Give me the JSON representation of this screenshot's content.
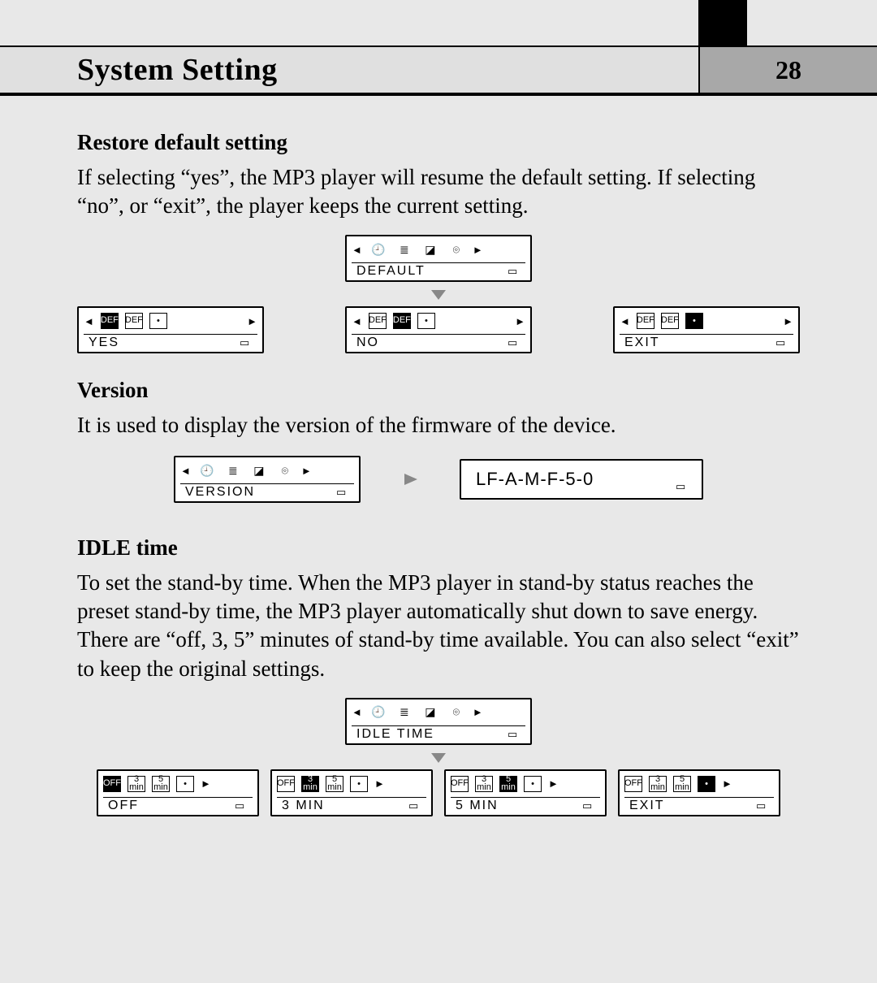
{
  "header": {
    "title": "System Setting",
    "page": "28"
  },
  "restore": {
    "heading": "Restore default setting",
    "body": "If selecting “yes”, the MP3 player will resume the default setting. If selecting “no”, or “exit”, the player keeps the current setting.",
    "menu_label": "DEFAULT",
    "options": [
      {
        "label": "YES"
      },
      {
        "label": "NO"
      },
      {
        "label": "EXIT"
      }
    ]
  },
  "version": {
    "heading": "Version",
    "body": "It is used to display the version of the firmware of the device.",
    "menu_label": "VERSION",
    "value": "LF-A-M-F-5-0"
  },
  "idle": {
    "heading": "IDLE time",
    "body": "To set the stand-by time. When the MP3 player in stand-by status reaches the  preset stand-by time, the MP3 player automatically shut down to save energy. There are “off, 3, 5” minutes of stand-by time available. You can also select “exit” to keep the original settings.",
    "menu_label": "IDLE TIME",
    "options": [
      {
        "label": "OFF"
      },
      {
        "label": "3 MIN"
      },
      {
        "label": "5 MIN"
      },
      {
        "label": "EXIT"
      }
    ]
  },
  "glyphs": {
    "batt": "▭",
    "def": "DEF",
    "exit_box": "•",
    "off": "OFF",
    "three": "3\nmin",
    "five": "5\nmin"
  }
}
